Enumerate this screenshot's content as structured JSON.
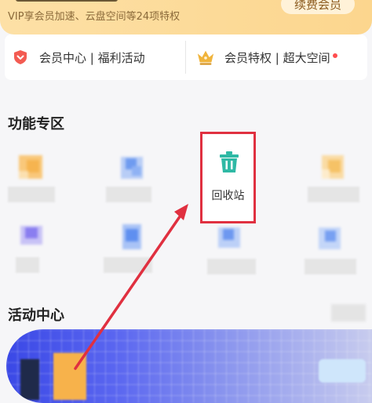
{
  "vip": {
    "subtitle": "VIP享会员加速、云盘空间等24项特权",
    "renew_label": "续费会员"
  },
  "entries": [
    {
      "label": "会员中心 | 福利活动",
      "icon": "shield-heart-icon",
      "color": "#f35b52"
    },
    {
      "label": "会员特权 | 超大空间",
      "icon": "crown-icon",
      "color": "#f0b43c",
      "badge": "red-dot"
    }
  ],
  "features": {
    "title": "功能专区",
    "recycle_label": "回收站",
    "recycle_icon": "trash-icon",
    "recycle_color": "#2fb9a5",
    "highlight_color": "#e03040"
  },
  "activity": {
    "title": "活动中心"
  },
  "annotation": {
    "arrow_color": "#e03040"
  }
}
